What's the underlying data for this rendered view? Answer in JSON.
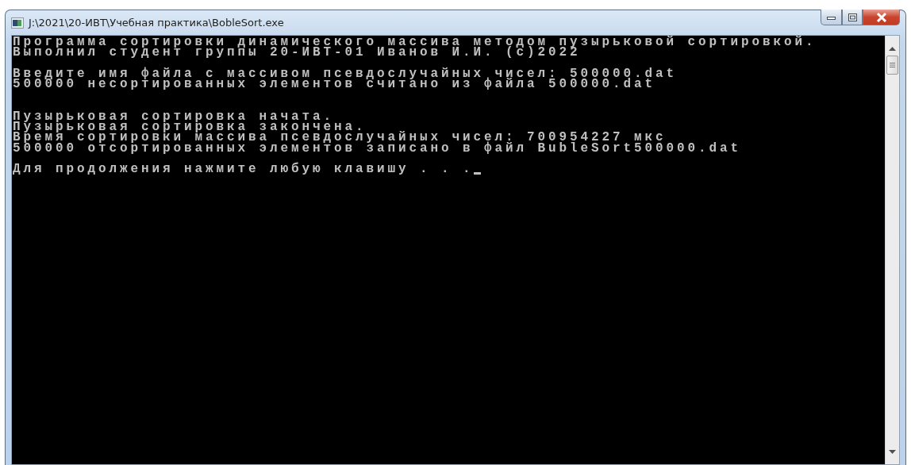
{
  "window": {
    "title": "J:\\2021\\20-ИВТ\\Учебная практика\\BobleSort.exe"
  },
  "console": {
    "blocks": [
      {
        "lines": [
          "Программа сортировки динамического массива методом пузырьковой сортировкой.",
          "Выполнил студент группы 20-ИВТ-01 Иванов И.И. (c)2022"
        ]
      },
      {
        "lines": [
          "Введите имя файла с массивом псевдослучайных чисел: 500000.dat",
          "500000 несортированных элементов считано из файла 500000.dat"
        ]
      },
      {
        "lines": [
          "Пузырьковая сортировка начата.",
          "Пузырьковая сортировка закончена.",
          "Время сортировки массива псевдослучайных чисел: 700954227 мкс",
          "500000 отсортированных элементов записано в файл BubleSort500000.dat"
        ]
      },
      {
        "lines": [
          "Для продолжения нажмите любую клавишу . . ."
        ]
      }
    ],
    "cursor_visible": true
  }
}
